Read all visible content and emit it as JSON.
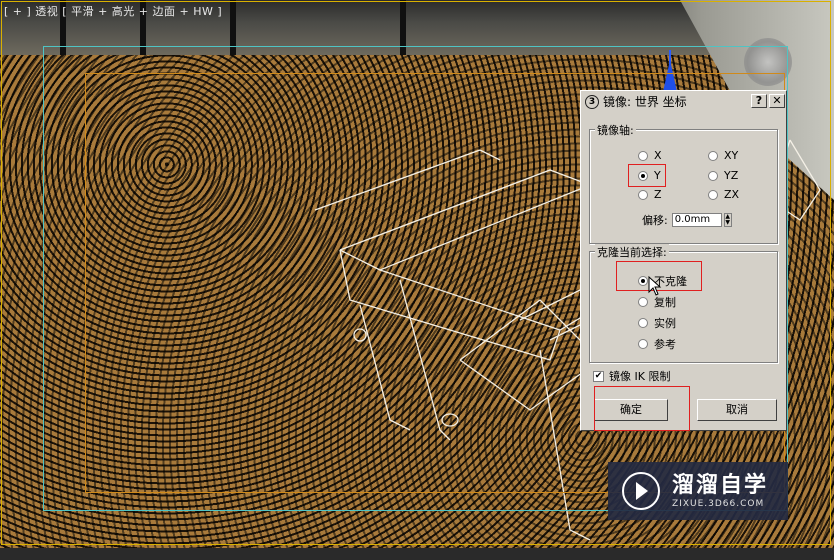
{
  "viewport": {
    "label": "[ + ] 透视 [ 平滑 + 高光 + 边面 + HW ]"
  },
  "dialog": {
    "title": "镜像: 世界 坐标",
    "help_label": "?",
    "close_label": "✕",
    "mirror_axis": {
      "title": "镜像轴:",
      "options": [
        "X",
        "Y",
        "Z",
        "XY",
        "YZ",
        "ZX"
      ],
      "selected": "Y",
      "offset_label": "偏移:",
      "offset_value": "0.0mm"
    },
    "clone_selection": {
      "title": "克隆当前选择:",
      "options": [
        "不克隆",
        "复制",
        "实例",
        "参考"
      ],
      "selected": "不克隆"
    },
    "mirror_ik": {
      "label": "镜像 IK 限制",
      "checked": true
    },
    "ok_label": "确定",
    "cancel_label": "取消"
  },
  "watermark": {
    "name": "溜溜自学",
    "url": "ZIXUE.3D66.COM"
  },
  "colors": {
    "highlight_red": "#e02020",
    "safe_frame_cyan": "#4fc4c4",
    "safe_frame_orange": "#d08a1a"
  }
}
